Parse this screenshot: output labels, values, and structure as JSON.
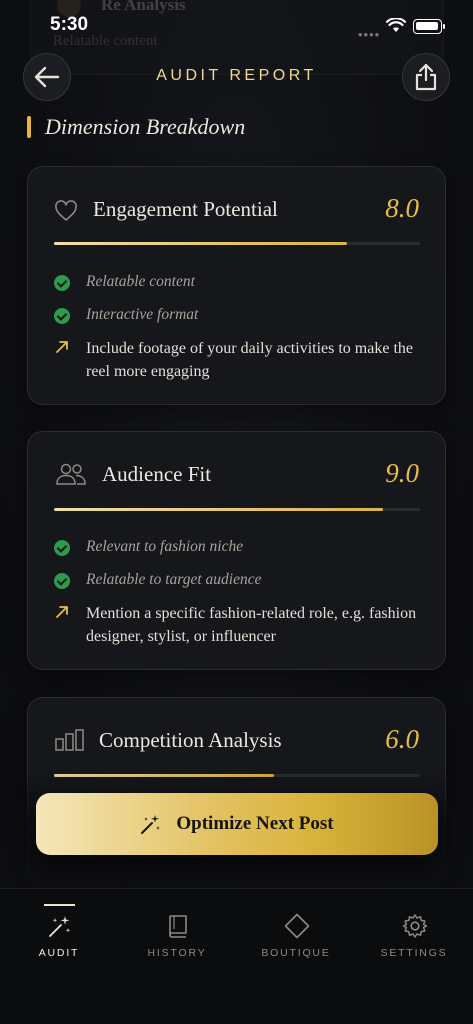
{
  "status_bar": {
    "time": "5:30",
    "signal": "••••"
  },
  "background_card": {
    "title": "Re Analysis",
    "subtitle": "Relatable content"
  },
  "header": {
    "title": "AUDIT REPORT",
    "back_icon": "arrow-left-icon",
    "share_icon": "share-icon"
  },
  "section": {
    "title": "Dimension Breakdown"
  },
  "dimensions": [
    {
      "icon": "heart-icon",
      "title": "Engagement Potential",
      "score": "8.0",
      "progress": 0.8,
      "positives": [
        "Relatable content",
        "Interactive format"
      ],
      "tip": "Include footage of your daily activities to make the reel more engaging"
    },
    {
      "icon": "users-icon",
      "title": "Audience Fit",
      "score": "9.0",
      "progress": 0.9,
      "positives": [
        "Relevant to fashion niche",
        "Relatable to target audience"
      ],
      "tip": "Mention a specific fashion-related role, e.g. fashion designer, stylist, or influencer"
    },
    {
      "icon": "bar-chart-icon",
      "title": "Competition Analysis",
      "score": "6.0",
      "progress": 0.6
    }
  ],
  "cta": {
    "label": "Optimize Next Post",
    "icon": "magic-wand-icon"
  },
  "tabs": [
    {
      "label": "AUDIT",
      "icon": "magic-wand-icon",
      "active": true
    },
    {
      "label": "HISTORY",
      "icon": "book-icon",
      "active": false
    },
    {
      "label": "BOUTIQUE",
      "icon": "diamond-icon",
      "active": false
    },
    {
      "label": "SETTINGS",
      "icon": "gear-icon",
      "active": false
    }
  ],
  "colors": {
    "accent": "#E8BD45",
    "positive": "#2D9A4E",
    "background": "#0C0D10",
    "card": "#15171B"
  }
}
